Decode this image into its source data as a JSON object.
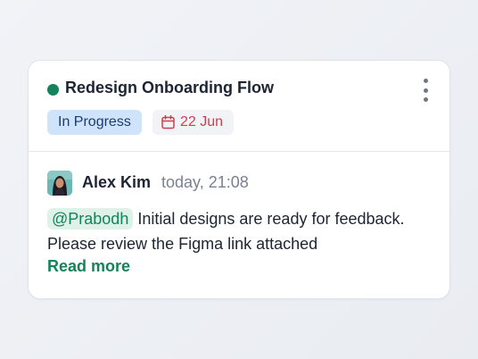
{
  "task": {
    "title": "Redesign Onboarding Flow",
    "status": "In Progress",
    "due_date": "22 Jun",
    "status_dot_color": "#13835c",
    "menu_icon": "more-vertical-icon",
    "date_icon": "calendar-icon"
  },
  "comment": {
    "author": "Alex Kim",
    "timestamp": "today, 21:08",
    "mention": "@Prabodh",
    "text": "Initial designs are ready for feedback. Please review the Figma link attached",
    "read_more": "Read more"
  },
  "colors": {
    "accent_green": "#13835c",
    "status_chip_bg": "#cfe3fb",
    "date_red": "#d33d4b"
  }
}
